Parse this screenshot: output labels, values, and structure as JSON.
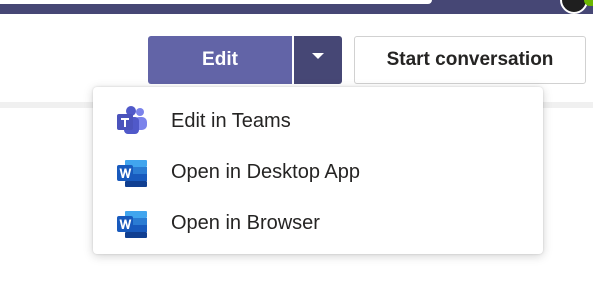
{
  "toolbar": {
    "edit_label": "Edit",
    "start_conversation_label": "Start conversation"
  },
  "menu": {
    "items": [
      {
        "label": "Edit in Teams",
        "icon": "teams-icon"
      },
      {
        "label": "Open in Desktop App",
        "icon": "word-icon"
      },
      {
        "label": "Open in Browser",
        "icon": "word-icon"
      }
    ]
  },
  "colors": {
    "brand": "#6264a7",
    "brand_dark": "#464775",
    "word_blue": "#185abd",
    "teams_purple": "#5059c9"
  }
}
